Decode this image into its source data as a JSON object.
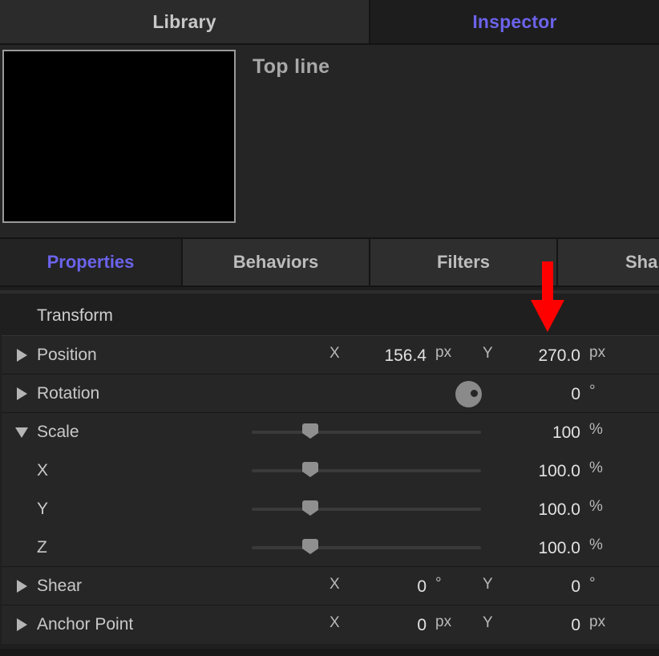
{
  "top_tabs": {
    "library": "Library",
    "inspector": "Inspector"
  },
  "preview": {
    "name": "Top line"
  },
  "sub_tabs": {
    "properties": "Properties",
    "behaviors": "Behaviors",
    "filters": "Filters",
    "shape": "Sha"
  },
  "section_title": "Transform",
  "rows": {
    "position": {
      "label": "Position",
      "x_axis": "X",
      "x_value": "156.4",
      "x_unit": "px",
      "y_axis": "Y",
      "y_value": "270.0",
      "y_unit": "px"
    },
    "rotation": {
      "label": "Rotation",
      "value": "0",
      "unit": "°"
    },
    "scale": {
      "label": "Scale",
      "value": "100",
      "unit": "%"
    },
    "scale_x": {
      "label": "X",
      "value": "100.0",
      "unit": "%"
    },
    "scale_y": {
      "label": "Y",
      "value": "100.0",
      "unit": "%"
    },
    "scale_z": {
      "label": "Z",
      "value": "100.0",
      "unit": "%"
    },
    "shear": {
      "label": "Shear",
      "x_axis": "X",
      "x_value": "0",
      "x_unit": "°",
      "y_axis": "Y",
      "y_value": "0",
      "y_unit": "°"
    },
    "anchor": {
      "label": "Anchor Point",
      "x_axis": "X",
      "x_value": "0",
      "x_unit": "px",
      "y_axis": "Y",
      "y_value": "0",
      "y_unit": "px"
    }
  },
  "colors": {
    "accent": "#6b63ea",
    "annotation_arrow": "#ff0000",
    "background": "#1f1f1f"
  },
  "icons": {
    "disclosure_collapsed": "triangle-right",
    "disclosure_expanded": "triangle-down",
    "rotation_dial": "dial",
    "annotation": "red-down-arrow"
  }
}
